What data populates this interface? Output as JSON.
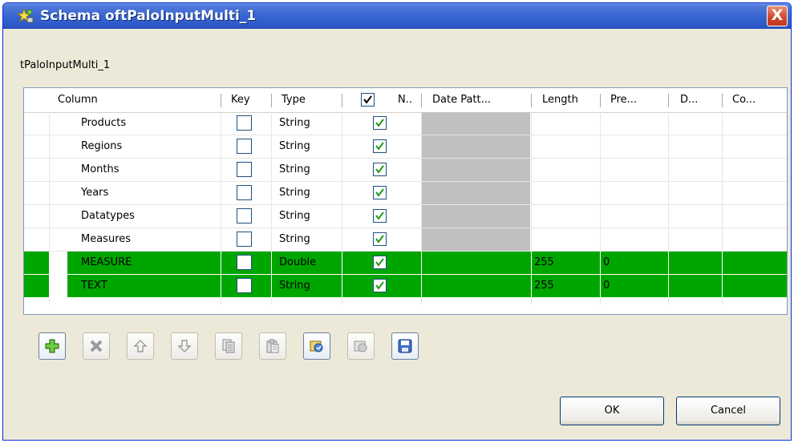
{
  "window": {
    "title": "Schema oftPaloInputMulti_1",
    "close_label": "X"
  },
  "schema_name": "tPaloInputMulti_1",
  "columns": {
    "column": "Column",
    "key": "Key",
    "type": "Type",
    "nullable": "N..",
    "date_pattern": "Date Patt...",
    "length": "Length",
    "precision": "Pre...",
    "default": "D...",
    "comment": "Co..."
  },
  "rows": [
    {
      "name": "Products",
      "key": false,
      "type": "String",
      "nullable": true,
      "length": "",
      "precision": "",
      "selected": false
    },
    {
      "name": "Regions",
      "key": false,
      "type": "String",
      "nullable": true,
      "length": "",
      "precision": "",
      "selected": false
    },
    {
      "name": "Months",
      "key": false,
      "type": "String",
      "nullable": true,
      "length": "",
      "precision": "",
      "selected": false
    },
    {
      "name": "Years",
      "key": false,
      "type": "String",
      "nullable": true,
      "length": "",
      "precision": "",
      "selected": false
    },
    {
      "name": "Datatypes",
      "key": false,
      "type": "String",
      "nullable": true,
      "length": "",
      "precision": "",
      "selected": false
    },
    {
      "name": "Measures",
      "key": false,
      "type": "String",
      "nullable": true,
      "length": "",
      "precision": "",
      "selected": false
    },
    {
      "name": "MEASURE",
      "key": false,
      "type": "Double",
      "nullable": true,
      "length": "255",
      "precision": "0",
      "selected": true
    },
    {
      "name": "TEXT",
      "key": false,
      "type": "String",
      "nullable": true,
      "length": "255",
      "precision": "0",
      "selected": true
    }
  ],
  "toolbar": [
    "add-icon",
    "remove-icon",
    "move-up-icon",
    "move-down-icon",
    "copy-icon",
    "paste-icon",
    "import-icon",
    "export-icon",
    "save-icon"
  ],
  "buttons": {
    "ok": "OK",
    "cancel": "Cancel"
  },
  "colors": {
    "selection": "#00a600",
    "titlebar": "#2d59c8",
    "date_pattern_disabled": "#c0c0c0"
  }
}
